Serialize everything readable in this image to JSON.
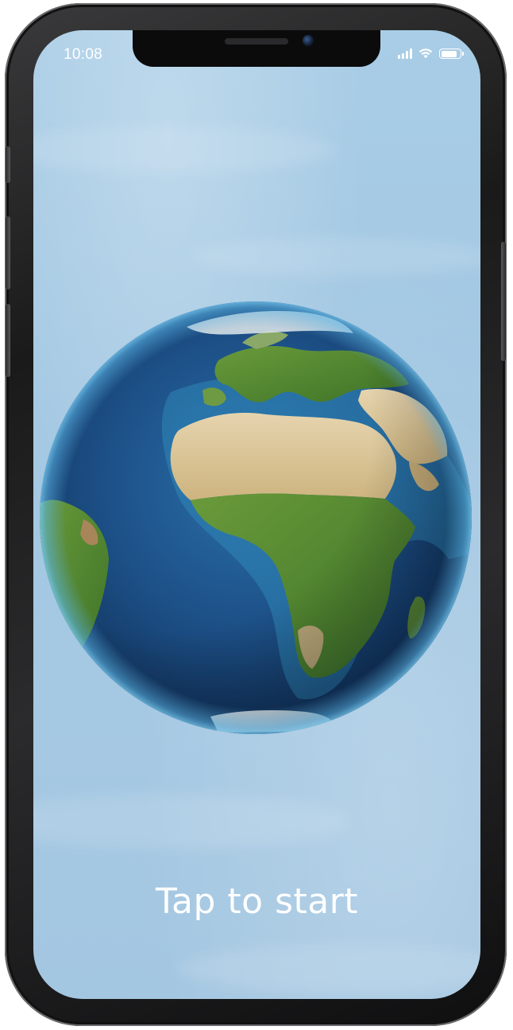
{
  "status_bar": {
    "time": "10:08",
    "signal_icon": "cellular-signal-icon",
    "wifi_icon": "wifi-icon",
    "battery_icon": "battery-icon",
    "battery_level": 0.9
  },
  "main": {
    "start_label": "Tap to start",
    "globe_image": "earth-globe-africa-europe"
  },
  "colors": {
    "sky_background": "#a6c9e3",
    "ocean_deep": "#1c4f86",
    "land_green": "#4f8a2e",
    "desert": "#d9c59a",
    "text": "#ffffff"
  }
}
